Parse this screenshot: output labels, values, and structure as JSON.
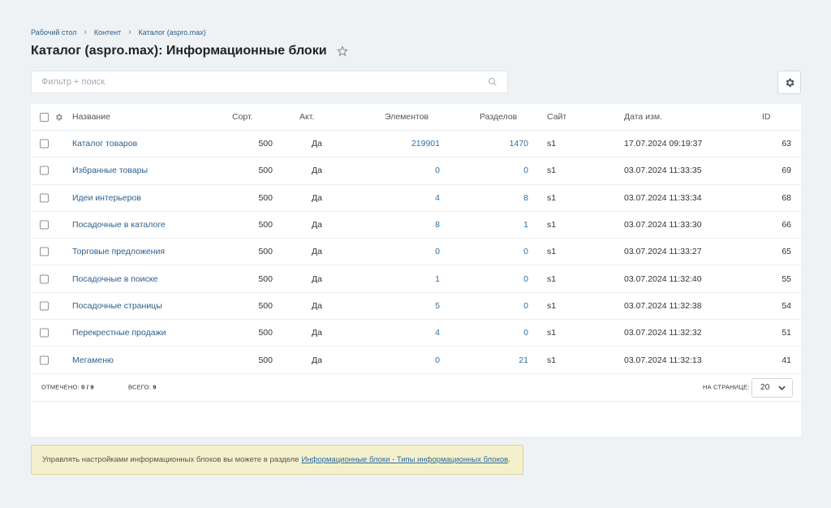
{
  "breadcrumb": [
    "Рабочий стол",
    "Контент",
    "Каталог (aspro.max)"
  ],
  "page_title": "Каталог (aspro.max): Информационные блоки",
  "filter": {
    "placeholder": "Фильтр + поиск"
  },
  "table": {
    "columns": {
      "name": "Название",
      "sort": "Сорт.",
      "active": "Акт.",
      "elements": "Элементов",
      "sections": "Разделов",
      "site": "Сайт",
      "date": "Дата изм.",
      "id": "ID"
    },
    "rows": [
      {
        "name": "Каталог товаров",
        "sort": "500",
        "active": "Да",
        "elements": "219901",
        "sections": "1470",
        "site": "s1",
        "date": "17.07.2024 09:19:37",
        "id": "63"
      },
      {
        "name": "Избранные товары",
        "sort": "500",
        "active": "Да",
        "elements": "0",
        "sections": "0",
        "site": "s1",
        "date": "03.07.2024 11:33:35",
        "id": "69"
      },
      {
        "name": "Идеи интерьеров",
        "sort": "500",
        "active": "Да",
        "elements": "4",
        "sections": "8",
        "site": "s1",
        "date": "03.07.2024 11:33:34",
        "id": "68"
      },
      {
        "name": "Посадочные в каталоге",
        "sort": "500",
        "active": "Да",
        "elements": "8",
        "sections": "1",
        "site": "s1",
        "date": "03.07.2024 11:33:30",
        "id": "66"
      },
      {
        "name": "Торговые предложения",
        "sort": "500",
        "active": "Да",
        "elements": "0",
        "sections": "0",
        "site": "s1",
        "date": "03.07.2024 11:33:27",
        "id": "65"
      },
      {
        "name": "Посадочные в поиске",
        "sort": "500",
        "active": "Да",
        "elements": "1",
        "sections": "0",
        "site": "s1",
        "date": "03.07.2024 11:32:40",
        "id": "55"
      },
      {
        "name": "Посадочные страницы",
        "sort": "500",
        "active": "Да",
        "elements": "5",
        "sections": "0",
        "site": "s1",
        "date": "03.07.2024 11:32:38",
        "id": "54"
      },
      {
        "name": "Перекрестные продажи",
        "sort": "500",
        "active": "Да",
        "elements": "4",
        "sections": "0",
        "site": "s1",
        "date": "03.07.2024 11:32:32",
        "id": "51"
      },
      {
        "name": "Мегаменю",
        "sort": "500",
        "active": "Да",
        "elements": "0",
        "sections": "21",
        "site": "s1",
        "date": "03.07.2024 11:32:13",
        "id": "41"
      }
    ]
  },
  "footer": {
    "selected_label": "ОТМЕЧЕНО:",
    "selected_value": "0 / 9",
    "total_label": "ВСЕГО:",
    "total_value": "9",
    "per_page_label": "НА СТРАНИЦЕ:",
    "per_page_value": "20"
  },
  "notice": {
    "text": "Управлять настройками информационных блоков вы можете в разделе",
    "link": "Информационные блоки - Типы информационных блоков",
    "suffix": "."
  }
}
